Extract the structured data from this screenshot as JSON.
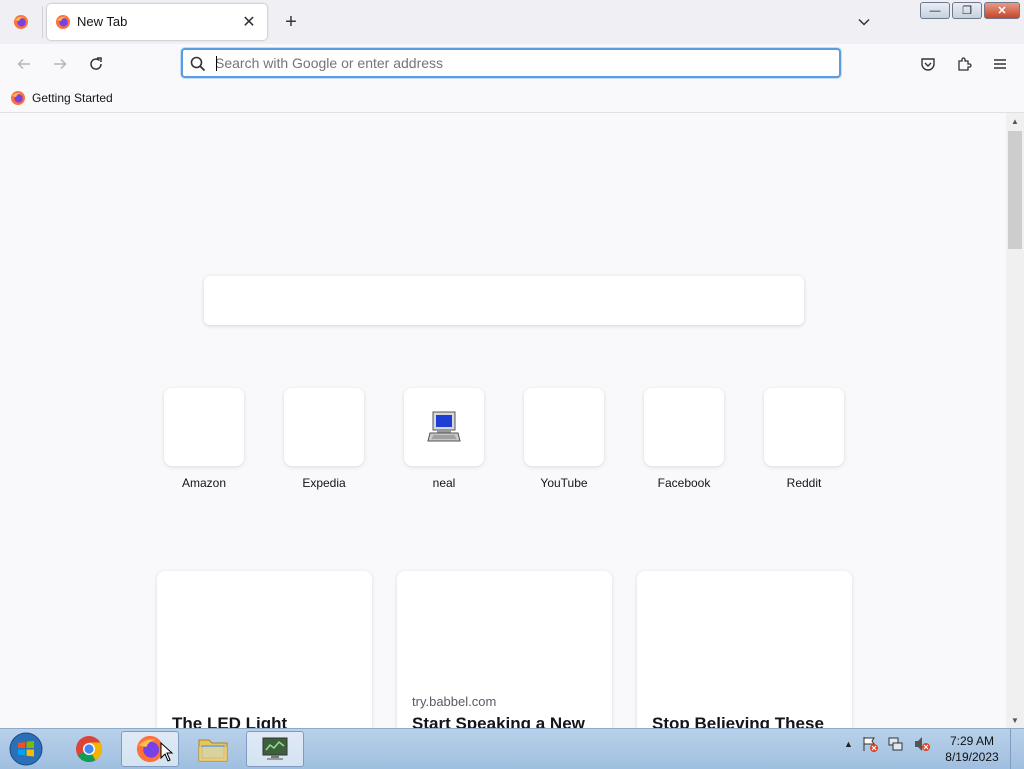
{
  "browser": {
    "tab": {
      "title": "New Tab",
      "close_glyph": "✕"
    },
    "new_tab_glyph": "+",
    "urlbar": {
      "placeholder": "Search with Google or enter address",
      "value": ""
    },
    "bookmarks": [
      {
        "label": "Getting Started"
      }
    ],
    "window_controls": {
      "minimize": "—",
      "restore": "❐",
      "close": "✕"
    }
  },
  "newtab": {
    "top_sites": [
      {
        "label": "Amazon"
      },
      {
        "label": "Expedia"
      },
      {
        "label": "neal",
        "icon": "computer-icon"
      },
      {
        "label": "YouTube"
      },
      {
        "label": "Facebook"
      },
      {
        "label": "Reddit"
      }
    ],
    "stories": [
      {
        "source": "",
        "title": "The LED Light"
      },
      {
        "source": "try.babbel.com",
        "title": "Start Speaking a New"
      },
      {
        "source": "",
        "title": "Stop Believing These"
      }
    ]
  },
  "taskbar": {
    "clock_time": "7:29 AM",
    "clock_date": "8/19/2023",
    "tray_arrow": "▲"
  },
  "colors": {
    "accent": "#5a9ddf",
    "firefox_orange": "#ff7139",
    "firefox_purple": "#7542e5"
  }
}
